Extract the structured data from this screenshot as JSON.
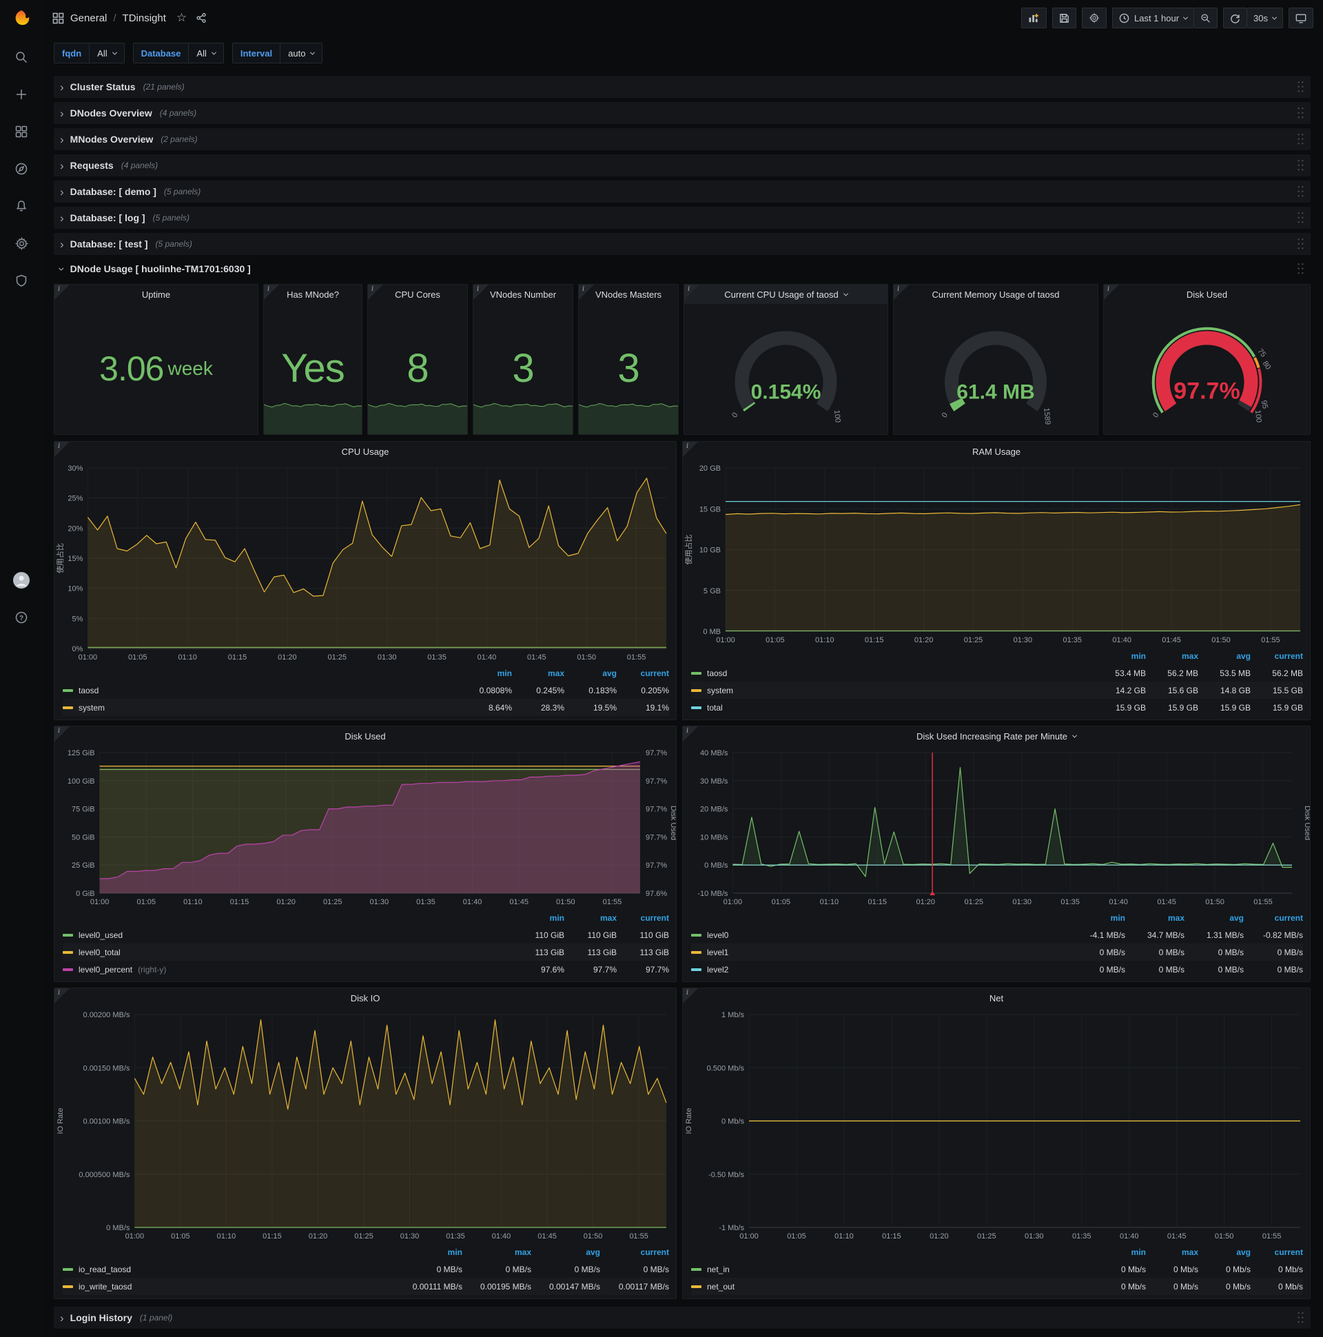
{
  "header": {
    "folder": "General",
    "separator": "/",
    "title": "TDinsight",
    "time_range": "Last 1 hour",
    "refresh": "30s"
  },
  "sidebar": {
    "icons": [
      "search",
      "plus",
      "dashboards",
      "explore",
      "alerting",
      "configuration",
      "server-admin"
    ],
    "bottom_icons": [
      "avatar",
      "help"
    ]
  },
  "variables": [
    {
      "label": "fqdn",
      "value": "All"
    },
    {
      "label": "Database",
      "value": "All"
    },
    {
      "label": "Interval",
      "value": "auto"
    }
  ],
  "rows": [
    {
      "title": "Cluster Status",
      "count": "(21 panels)"
    },
    {
      "title": "DNodes Overview",
      "count": "(4 panels)"
    },
    {
      "title": "MNodes Overview",
      "count": "(2 panels)"
    },
    {
      "title": "Requests",
      "count": "(4 panels)"
    },
    {
      "title": "Database: [ demo ]",
      "count": "(5 panels)"
    },
    {
      "title": "Database: [ log ]",
      "count": "(5 panels)"
    },
    {
      "title": "Database: [ test ]",
      "count": "(5 panels)"
    }
  ],
  "expanded_row": {
    "title": "DNode Usage [ huolinhe-TM1701:6030 ]"
  },
  "login_row": {
    "title": "Login History",
    "count": "(1 panel)"
  },
  "colors": {
    "green": "#73bf69",
    "yellow": "#eab839",
    "blue": "#6ed0e0",
    "purple": "#ba43a9",
    "red": "#e02f44",
    "orange": "#ff9830",
    "legend_header": "#33a2e5"
  },
  "stats": [
    {
      "id": "uptime",
      "title": "Uptime",
      "value": "3.06",
      "unit": "week",
      "spark": false
    },
    {
      "id": "mnode",
      "title": "Has MNode?",
      "value": "Yes",
      "unit": "",
      "spark": true
    },
    {
      "id": "cores",
      "title": "CPU Cores",
      "value": "8",
      "unit": "",
      "spark": true
    },
    {
      "id": "vnodes",
      "title": "VNodes Number",
      "value": "3",
      "unit": "",
      "spark": true
    },
    {
      "id": "masters",
      "title": "VNodes Masters",
      "value": "3",
      "unit": "",
      "spark": true
    }
  ],
  "xticks": [
    "01:00",
    "01:05",
    "01:10",
    "01:15",
    "01:20",
    "01:25",
    "01:30",
    "01:35",
    "01:40",
    "01:45",
    "01:50",
    "01:55"
  ],
  "x_total_minutes": 58,
  "chart_data": [
    {
      "id": "gauge-cpu",
      "type": "gauge",
      "title": "Current CPU Usage of taosd",
      "menu": true,
      "value": 0.154,
      "display": "0.154%",
      "min": 0,
      "max": 100,
      "value_color": "green",
      "labels": [
        {
          "v": 0,
          "t": "0"
        },
        {
          "v": 100,
          "t": "100"
        }
      ]
    },
    {
      "id": "gauge-mem",
      "type": "gauge",
      "title": "Current Memory Usage of taosd",
      "menu": false,
      "value": 61.4,
      "display": "61.4 MB",
      "min": 0,
      "max": 1589,
      "value_color": "green",
      "labels": [
        {
          "v": 0,
          "t": "0"
        },
        {
          "v": 1589,
          "t": "1589"
        }
      ]
    },
    {
      "id": "gauge-disk",
      "type": "gauge",
      "title": "Disk Used",
      "menu": false,
      "value": 97.7,
      "display": "97.7%",
      "min": 0,
      "max": 100,
      "value_color": "red",
      "big": true,
      "thresholds": [
        {
          "from": 0,
          "to": 75,
          "color": "green"
        },
        {
          "from": 75,
          "to": 80,
          "color": "orange"
        },
        {
          "from": 80,
          "to": 100,
          "color": "red"
        }
      ],
      "labels": [
        {
          "v": 0,
          "t": "0"
        },
        {
          "v": 75,
          "t": "75"
        },
        {
          "v": 80,
          "t": "80"
        },
        {
          "v": 95,
          "t": "95"
        },
        {
          "v": 100,
          "t": "100"
        }
      ]
    },
    {
      "id": "cpu",
      "type": "line",
      "title": "CPU Usage",
      "ylabel": "使用占比",
      "ymin": 0,
      "ymax": 30,
      "yticks": [
        {
          "v": 0,
          "t": "0%"
        },
        {
          "v": 5,
          "t": "5%"
        },
        {
          "v": 10,
          "t": "10%"
        },
        {
          "v": 15,
          "t": "15%"
        },
        {
          "v": 20,
          "t": "20%"
        },
        {
          "v": 25,
          "t": "25%"
        },
        {
          "v": 30,
          "t": "30%"
        }
      ],
      "series": [
        {
          "name": "taosd",
          "color": "green",
          "fill": 0.12,
          "values": [
            0.2,
            0.2
          ]
        },
        {
          "name": "system",
          "color": "yellow",
          "fill": 0.12,
          "values": [
            21.8,
            19.7,
            22,
            16.6,
            16.2,
            17.3,
            18.8,
            17.4,
            17.7,
            13.4,
            18.3,
            21,
            18.1,
            18,
            15.1,
            14.4,
            16.6,
            12.9,
            9.4,
            11.9,
            12.2,
            9.3,
            9.9,
            8.7,
            8.8,
            14.2,
            16.4,
            17.5,
            24.5,
            18.9,
            16.9,
            15.3,
            20.4,
            20.6,
            25.1,
            22.9,
            23.2,
            18.7,
            18.4,
            20.9,
            16.6,
            17.2,
            28,
            23.2,
            22,
            16.8,
            18.3,
            23.7,
            17.1,
            15.4,
            15.8,
            19.2,
            21.4,
            23.4,
            17.9,
            20.3,
            25.9,
            28.3,
            21.7,
            19.1
          ]
        }
      ],
      "legend": {
        "cols": [
          "min",
          "max",
          "avg",
          "current"
        ],
        "rows": [
          {
            "name": "taosd",
            "color": "green",
            "values": [
              "0.0808%",
              "0.245%",
              "0.183%",
              "0.205%"
            ]
          },
          {
            "name": "system",
            "color": "yellow",
            "values": [
              "8.64%",
              "28.3%",
              "19.5%",
              "19.1%"
            ]
          }
        ]
      }
    },
    {
      "id": "ram",
      "type": "line",
      "title": "RAM Usage",
      "ylabel": "使用占比",
      "ymin": 0,
      "ymax": 20,
      "yticks": [
        {
          "v": 0,
          "t": "0 MB"
        },
        {
          "v": 5,
          "t": "5 GB"
        },
        {
          "v": 10,
          "t": "10 GB"
        },
        {
          "v": 15,
          "t": "15 GB"
        },
        {
          "v": 20,
          "t": "20 GB"
        }
      ],
      "series": [
        {
          "name": "taosd",
          "color": "green",
          "fill": 0.15,
          "values": [
            0.055,
            0.055
          ]
        },
        {
          "name": "system",
          "color": "yellow",
          "fill": 0.11,
          "values": [
            14.3,
            14.4,
            14.35,
            14.42,
            14.45,
            14.38,
            14.42,
            14.4,
            14.36,
            14.44,
            14.42,
            14.46,
            14.4,
            14.38,
            14.44,
            14.48,
            14.42,
            14.4,
            14.46,
            14.5,
            14.44,
            14.42,
            14.48,
            14.52,
            14.46,
            14.44,
            14.5,
            14.54,
            14.48,
            14.52,
            14.56,
            14.5,
            14.54,
            14.58,
            14.52,
            14.56,
            14.6,
            14.65,
            14.6,
            14.62,
            14.68,
            14.72,
            14.7,
            14.75,
            14.82,
            14.9,
            15.0,
            15.15,
            15.3,
            15.5
          ]
        },
        {
          "name": "total",
          "color": "blue",
          "fill": 0,
          "values": [
            15.9,
            15.9
          ]
        }
      ],
      "legend": {
        "cols": [
          "min",
          "max",
          "avg",
          "current"
        ],
        "rows": [
          {
            "name": "taosd",
            "color": "green",
            "values": [
              "53.4 MB",
              "56.2 MB",
              "53.5 MB",
              "56.2 MB"
            ]
          },
          {
            "name": "system",
            "color": "yellow",
            "values": [
              "14.2 GB",
              "15.6 GB",
              "14.8 GB",
              "15.5 GB"
            ]
          },
          {
            "name": "total",
            "color": "blue",
            "values": [
              "15.9 GB",
              "15.9 GB",
              "15.9 GB",
              "15.9 GB"
            ]
          }
        ]
      }
    },
    {
      "id": "disk",
      "type": "line",
      "title": "Disk Used",
      "ymin": 0,
      "ymax": 125,
      "yticks": [
        {
          "v": 0,
          "t": "0 GiB"
        },
        {
          "v": 25,
          "t": "25 GiB"
        },
        {
          "v": 50,
          "t": "50 GiB"
        },
        {
          "v": 75,
          "t": "75 GiB"
        },
        {
          "v": 100,
          "t": "100 GiB"
        },
        {
          "v": 125,
          "t": "125 GiB"
        }
      ],
      "y2min": 97.575,
      "y2max": 97.73,
      "right_ticks": [
        "97.6%",
        "97.7%",
        "97.7%",
        "97.7%",
        "97.7%",
        "97.7%"
      ],
      "right_label": "Disk Used",
      "series": [
        {
          "name": "level0_used",
          "color": "green",
          "fill": 0.1,
          "values": [
            110,
            110
          ]
        },
        {
          "name": "level0_total",
          "color": "yellow",
          "fill": 0.1,
          "values": [
            113,
            113
          ]
        },
        {
          "name": "level0_percent",
          "color": "purple",
          "fill": 0.3,
          "axis": "right",
          "values": [
            97.591,
            97.591,
            97.593,
            97.599,
            97.599,
            97.6,
            97.6,
            97.602,
            97.602,
            97.609,
            97.609,
            97.611,
            97.617,
            97.619,
            97.619,
            97.627,
            97.629,
            97.629,
            97.63,
            97.632,
            97.639,
            97.639,
            97.644,
            97.645,
            97.645,
            97.668,
            97.668,
            97.67,
            97.67,
            97.671,
            97.671,
            97.672,
            97.672,
            97.695,
            97.695,
            97.696,
            97.696,
            97.697,
            97.697,
            97.697,
            97.698,
            97.698,
            97.698,
            97.699,
            97.699,
            97.7,
            97.7,
            97.703,
            97.703,
            97.704,
            97.704,
            97.705,
            97.705,
            97.706,
            97.71,
            97.712,
            97.714,
            97.716,
            97.718,
            97.72
          ]
        }
      ],
      "legend": {
        "cols": [
          "min",
          "max",
          "current"
        ],
        "rows": [
          {
            "name": "level0_used",
            "color": "green",
            "values": [
              "110 GiB",
              "110 GiB",
              "110 GiB"
            ]
          },
          {
            "name": "level0_total",
            "color": "yellow",
            "values": [
              "113 GiB",
              "113 GiB",
              "113 GiB"
            ]
          },
          {
            "name": "level0_percent",
            "color": "purple",
            "suffix": "(right-y)",
            "values": [
              "97.6%",
              "97.7%",
              "97.7%"
            ]
          }
        ]
      }
    },
    {
      "id": "rate",
      "type": "line",
      "title": "Disk Used Increasing Rate per Minute",
      "menu": true,
      "ymin": -10,
      "ymax": 40,
      "yticks": [
        {
          "v": -10,
          "t": "-10 MB/s"
        },
        {
          "v": 0,
          "t": "0 MB/s"
        },
        {
          "v": 10,
          "t": "10 MB/s"
        },
        {
          "v": 20,
          "t": "20 MB/s"
        },
        {
          "v": 30,
          "t": "30 MB/s"
        },
        {
          "v": 40,
          "t": "40 MB/s"
        }
      ],
      "right_label": "Disk Used",
      "annotation_x": 0.357,
      "series": [
        {
          "name": "level0",
          "color": "green",
          "fill": 0.12,
          "values": [
            0.3,
            0.2,
            17,
            0.4,
            -0.5,
            0.3,
            0.4,
            12,
            0.5,
            0.2,
            0.3,
            0.4,
            0.2,
            0.5,
            -4.1,
            20.5,
            0.4,
            11.8,
            0.3,
            0.2,
            0.4,
            0.3,
            0.5,
            0.2,
            34.7,
            -3,
            0.4,
            0.3,
            0.2,
            0.5,
            0.3,
            0.4,
            0.2,
            0.3,
            20,
            0.4,
            0.2,
            0.3,
            0.5,
            0.2,
            1,
            0.3,
            0.4,
            0.2,
            0.5,
            0.3,
            0.2,
            0.4,
            0.3,
            0.5,
            0.2,
            0.4,
            0.3,
            0.2,
            0.5,
            0.3,
            0.2,
            7.8,
            -0.8,
            -0.82
          ]
        },
        {
          "name": "level1",
          "color": "yellow",
          "fill": 0,
          "values": [
            0,
            0
          ]
        },
        {
          "name": "level2",
          "color": "blue",
          "fill": 0,
          "values": [
            0,
            0
          ]
        }
      ],
      "legend": {
        "cols": [
          "min",
          "max",
          "avg",
          "current"
        ],
        "rows": [
          {
            "name": "level0",
            "color": "green",
            "values": [
              "-4.1 MB/s",
              "34.7 MB/s",
              "1.31 MB/s",
              "-0.82 MB/s"
            ]
          },
          {
            "name": "level1",
            "color": "yellow",
            "values": [
              "0 MB/s",
              "0 MB/s",
              "0 MB/s",
              "0 MB/s"
            ]
          },
          {
            "name": "level2",
            "color": "blue",
            "values": [
              "0 MB/s",
              "0 MB/s",
              "0 MB/s",
              "0 MB/s"
            ]
          }
        ]
      }
    },
    {
      "id": "io",
      "type": "line",
      "title": "Disk IO",
      "ylabel": "IO Rate",
      "ymin": 0,
      "ymax": 0.002,
      "yticks": [
        {
          "v": 0,
          "t": "0 MB/s"
        },
        {
          "v": 0.0005,
          "t": "0.000500 MB/s"
        },
        {
          "v": 0.001,
          "t": "0.00100 MB/s"
        },
        {
          "v": 0.0015,
          "t": "0.00150 MB/s"
        },
        {
          "v": 0.002,
          "t": "0.00200 MB/s"
        }
      ],
      "series": [
        {
          "name": "io_read_taosd",
          "color": "green",
          "fill": 0,
          "values": [
            0,
            0
          ]
        },
        {
          "name": "io_write_taosd",
          "color": "yellow",
          "fill": 0.12,
          "values": [
            0.0014,
            0.00125,
            0.0016,
            0.00135,
            0.00155,
            0.0013,
            0.00165,
            0.00115,
            0.00175,
            0.0013,
            0.0015,
            0.00125,
            0.0017,
            0.00135,
            0.00195,
            0.00125,
            0.00155,
            0.00111,
            0.0016,
            0.0013,
            0.00185,
            0.00125,
            0.0015,
            0.00135,
            0.00175,
            0.00115,
            0.0016,
            0.0013,
            0.0019,
            0.00125,
            0.00145,
            0.0012,
            0.0018,
            0.00135,
            0.00165,
            0.00115,
            0.00185,
            0.0013,
            0.00155,
            0.00125,
            0.00195,
            0.0013,
            0.0016,
            0.00115,
            0.00175,
            0.00135,
            0.0015,
            0.00125,
            0.00185,
            0.0012,
            0.00165,
            0.0013,
            0.0019,
            0.00125,
            0.00155,
            0.00135,
            0.0017,
            0.00125,
            0.0014,
            0.00117
          ]
        }
      ],
      "legend": {
        "cols": [
          "min",
          "max",
          "avg",
          "current"
        ],
        "rows": [
          {
            "name": "io_read_taosd",
            "color": "green",
            "values": [
              "0 MB/s",
              "0 MB/s",
              "0 MB/s",
              "0 MB/s"
            ]
          },
          {
            "name": "io_write_taosd",
            "color": "yellow",
            "values": [
              "0.00111 MB/s",
              "0.00195 MB/s",
              "0.00147 MB/s",
              "0.00117 MB/s"
            ]
          }
        ]
      }
    },
    {
      "id": "net",
      "type": "line",
      "title": "Net",
      "ylabel": "IO Rate",
      "ymin": -1,
      "ymax": 1,
      "yticks": [
        {
          "v": -1,
          "t": "-1 Mb/s"
        },
        {
          "v": -0.5,
          "t": "-0.50 Mb/s"
        },
        {
          "v": 0,
          "t": "0 Mb/s"
        },
        {
          "v": 0.5,
          "t": "0.500 Mb/s"
        },
        {
          "v": 1,
          "t": "1 Mb/s"
        }
      ],
      "series": [
        {
          "name": "net_in",
          "color": "green",
          "fill": 0,
          "values": [
            0,
            0
          ]
        },
        {
          "name": "net_out",
          "color": "yellow",
          "fill": 0,
          "values": [
            0,
            0
          ]
        }
      ],
      "legend": {
        "cols": [
          "min",
          "max",
          "avg",
          "current"
        ],
        "rows": [
          {
            "name": "net_in",
            "color": "green",
            "values": [
              "0 Mb/s",
              "0 Mb/s",
              "0 Mb/s",
              "0 Mb/s"
            ]
          },
          {
            "name": "net_out",
            "color": "yellow",
            "values": [
              "0 Mb/s",
              "0 Mb/s",
              "0 Mb/s",
              "0 Mb/s"
            ]
          }
        ]
      }
    }
  ]
}
